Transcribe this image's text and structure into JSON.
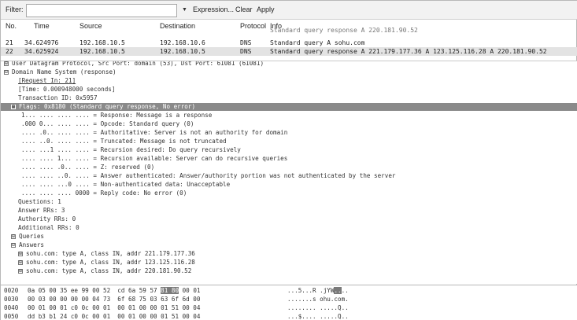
{
  "toolbar": {
    "filter_label": "Filter:",
    "filter_value": "",
    "dropdown_glyph": "▼",
    "expression_label": "Expression...",
    "clear_label": "Clear",
    "apply_label": "Apply"
  },
  "packet_list": {
    "headers": {
      "no": "No.",
      "time": "Time",
      "source": "Source",
      "destination": "Destination",
      "protocol": "Protocol",
      "info": "Info"
    },
    "rows": [
      {
        "no": "",
        "time": "",
        "source": "",
        "destination": "",
        "protocol": "",
        "info": "Standard query response A 220.181.90.52"
      },
      {
        "no": "21",
        "time": "34.624976",
        "source": "192.168.10.5",
        "destination": "192.168.10.6",
        "protocol": "DNS",
        "info": "Standard query A sohu.com"
      },
      {
        "no": "22",
        "time": "34.625924",
        "source": "192.168.10.5",
        "destination": "192.168.10.5",
        "protocol": "DNS",
        "info": "Standard query response A 221.179.177.36 A 123.125.116.28 A 220.181.90.52"
      }
    ]
  },
  "details": {
    "lines": [
      {
        "box": "⊞",
        "text": "User Datagram Protocol, Src Port: domain (53), Dst Port: 61081 (61081)"
      },
      {
        "box": "⊟",
        "text": "Domain Name System (response)"
      },
      {
        "box": "",
        "text": "[Request In: 21]"
      },
      {
        "box": "",
        "text": "[Time: 0.000948000 seconds]"
      },
      {
        "box": "",
        "text": "Transaction ID: 0x5957"
      },
      {
        "box": "⊟",
        "text": "Flags: 0x8180 (Standard query response, No error)"
      },
      {
        "box": "",
        "text": "1... .... .... .... = Response: Message is a response"
      },
      {
        "box": "",
        "text": ".000 0... .... .... = Opcode: Standard query (0)"
      },
      {
        "box": "",
        "text": ".... .0.. .... .... = Authoritative: Server is not an authority for domain"
      },
      {
        "box": "",
        "text": ".... ..0. .... .... = Truncated: Message is not truncated"
      },
      {
        "box": "",
        "text": ".... ...1 .... .... = Recursion desired: Do query recursively"
      },
      {
        "box": "",
        "text": ".... .... 1... .... = Recursion available: Server can do recursive queries"
      },
      {
        "box": "",
        "text": ".... .... .0.. .... = Z: reserved (0)"
      },
      {
        "box": "",
        "text": ".... .... ..0. .... = Answer authenticated: Answer/authority portion was not authenticated by the server"
      },
      {
        "box": "",
        "text": ".... .... ...0 .... = Non-authenticated data: Unacceptable"
      },
      {
        "box": "",
        "text": ".... .... .... 0000 = Reply code: No error (0)"
      },
      {
        "box": "",
        "text": "Questions: 1"
      },
      {
        "box": "",
        "text": "Answer RRs: 3"
      },
      {
        "box": "",
        "text": "Authority RRs: 0"
      },
      {
        "box": "",
        "text": "Additional RRs: 0"
      },
      {
        "box": "⊞",
        "text": "Queries"
      },
      {
        "box": "⊟",
        "text": "Answers"
      },
      {
        "box": "⊞",
        "text": "sohu.com: type A, class IN, addr 221.179.177.36"
      },
      {
        "box": "⊞",
        "text": "sohu.com: type A, class IN, addr 123.125.116.28"
      },
      {
        "box": "⊞",
        "text": "sohu.com: type A, class IN, addr 220.181.90.52"
      }
    ]
  },
  "hex": {
    "rows": [
      {
        "offset": "0020",
        "pre": "0a 05 00 35 ee 99 00 52  cd 6a 59 57 ",
        "sel": "81 80",
        "post": " 00 01",
        "ascii_pre": "...5...R .jYW",
        "ascii_sel": "..",
        "ascii_post": ".."
      },
      {
        "offset": "0030",
        "pre": "00 03 00 00 00 00 04 73  6f 68 75 03 63 6f 6d 00",
        "sel": "",
        "post": "",
        "ascii_pre": ".......s ohu.com.",
        "ascii_sel": "",
        "ascii_post": ""
      },
      {
        "offset": "0040",
        "pre": "00 01 00 01 c0 0c 00 01  00 01 00 00 01 51 00 04",
        "sel": "",
        "post": "",
        "ascii_pre": "........ .....Q..",
        "ascii_sel": "",
        "ascii_post": ""
      },
      {
        "offset": "0050",
        "pre": "dd b3 b1 24 c0 0c 00 01  00 01 00 00 01 51 00 04",
        "sel": "",
        "post": "",
        "ascii_pre": "...$.... .....Q..",
        "ascii_sel": "",
        "ascii_post": ""
      }
    ]
  }
}
